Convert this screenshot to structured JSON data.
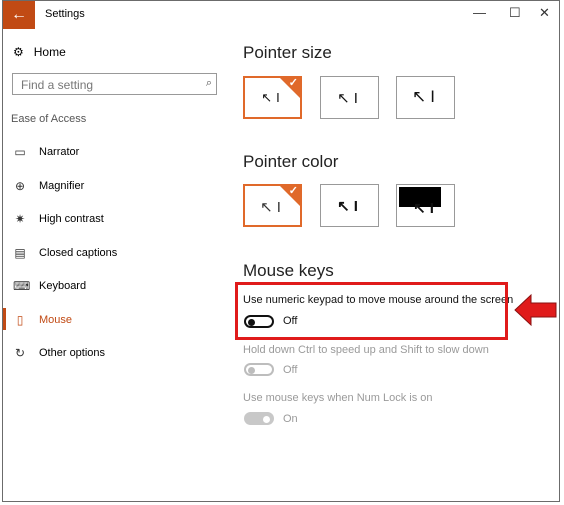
{
  "window": {
    "title": "Settings"
  },
  "sidebar": {
    "home_label": "Home",
    "search_placeholder": "Find a setting",
    "section_label": "Ease of Access",
    "items": [
      {
        "label": "Narrator",
        "icon": "narrator-icon"
      },
      {
        "label": "Magnifier",
        "icon": "magnifier-icon"
      },
      {
        "label": "High contrast",
        "icon": "contrast-icon"
      },
      {
        "label": "Closed captions",
        "icon": "captions-icon"
      },
      {
        "label": "Keyboard",
        "icon": "keyboard-icon"
      },
      {
        "label": "Mouse",
        "icon": "mouse-icon",
        "selected": true
      },
      {
        "label": "Other options",
        "icon": "other-options-icon"
      }
    ]
  },
  "main": {
    "pointer_size": {
      "heading": "Pointer size",
      "selected_index": 0
    },
    "pointer_color": {
      "heading": "Pointer color",
      "selected_index": 0
    },
    "mouse_keys": {
      "heading": "Mouse keys",
      "numeric_keypad": {
        "label": "Use numeric keypad to move mouse around the screen",
        "state": "Off"
      },
      "ctrl_shift": {
        "label": "Hold down Ctrl to speed up and Shift to slow down",
        "state": "Off"
      },
      "num_lock": {
        "label": "Use mouse keys when Num Lock is on",
        "state": "On"
      }
    }
  },
  "colors": {
    "accent": "#c14a14",
    "tile_selected": "#e0692a",
    "annotation": "#e01b1b"
  }
}
